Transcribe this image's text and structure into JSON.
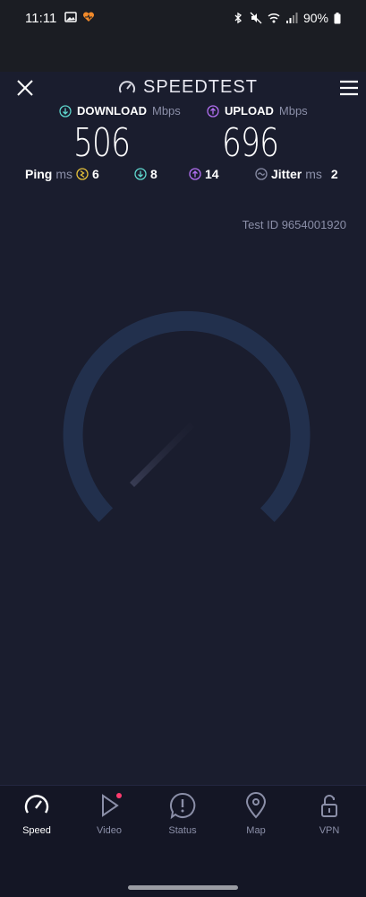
{
  "status_bar": {
    "time": "11:11",
    "battery": "90%"
  },
  "header": {
    "title": "SPEEDTEST"
  },
  "download": {
    "label": "DOWNLOAD",
    "unit": "Mbps",
    "value": "506",
    "color": "#5fd8cf"
  },
  "upload": {
    "label": "UPLOAD",
    "unit": "Mbps",
    "value": "696",
    "color": "#b470f4"
  },
  "ping": {
    "label": "Ping",
    "unit": "ms",
    "idle": "6",
    "download": "8",
    "upload": "14"
  },
  "jitter": {
    "label": "Jitter",
    "unit": "ms",
    "value": "2"
  },
  "test_id": "Test ID 9654001920",
  "nav": {
    "items": [
      {
        "label": "Speed",
        "icon": "speed-icon"
      },
      {
        "label": "Video",
        "icon": "play-icon"
      },
      {
        "label": "Status",
        "icon": "status-icon"
      },
      {
        "label": "Map",
        "icon": "map-pin-icon"
      },
      {
        "label": "VPN",
        "icon": "lock-icon"
      }
    ]
  },
  "colors": {
    "background": "#1a1d2e",
    "gauge_track": "#22304d",
    "idle_ping": "#e7c23a",
    "notification_dot": "#ff3b6e"
  }
}
